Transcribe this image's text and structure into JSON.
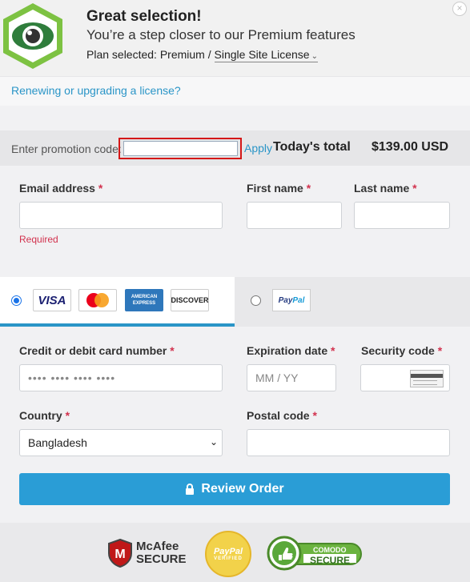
{
  "header": {
    "title": "Great selection!",
    "subtitle": "You’re a step closer to our Premium features",
    "plan_prefix": "Plan selected: Premium /",
    "plan_license": "Single Site License",
    "close_symbol": "×"
  },
  "renew": {
    "link": "Renewing or upgrading a license?"
  },
  "promo": {
    "label": "Enter promotion code:",
    "input_value": "",
    "apply": "Apply",
    "total_label": "Today's total",
    "total_value": "$139.00 USD"
  },
  "account": {
    "email_label": "Email address",
    "email_value": "",
    "email_error": "Required",
    "first_label": "First name",
    "first_value": "",
    "last_label": "Last name",
    "last_value": "",
    "required_mark": "*"
  },
  "payment": {
    "selected": "card",
    "card_brands": [
      "VISA",
      "MasterCard",
      "AMERICAN EXPRESS",
      "DISCOVER"
    ],
    "paypal_a": "Pay",
    "paypal_b": "Pal",
    "card_number_label": "Credit or debit card number",
    "card_number_placeholder": "•••• •••• •••• ••••",
    "expiry_label": "Expiration date",
    "expiry_placeholder": "MM / YY",
    "security_label": "Security code",
    "country_label": "Country",
    "country_value": "Bangladesh",
    "postal_label": "Postal code",
    "postal_value": ""
  },
  "review": {
    "label": "Review Order",
    "icon": "lock-icon"
  },
  "badges": {
    "mcafee_line1": "McAfee",
    "mcafee_line2": "SECURE",
    "paypal_line1": "PayPal",
    "paypal_line2": "VERIFIED",
    "comodo_line1": "COMODO",
    "comodo_line2": "SECURE"
  },
  "colors": {
    "accent": "#2a9dd6",
    "link": "#2a95c7",
    "error": "#d2324e",
    "highlight": "#d41717"
  }
}
